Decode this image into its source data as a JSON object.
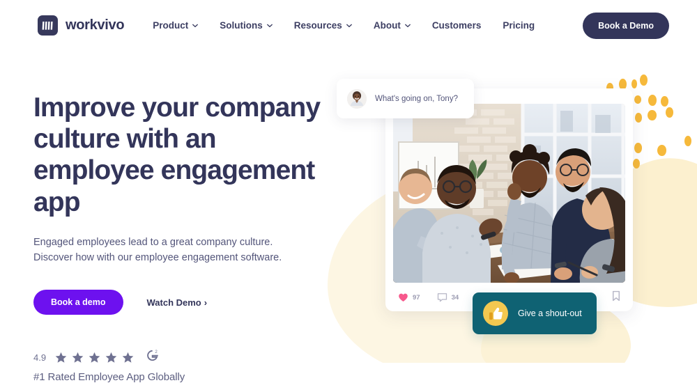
{
  "brand": {
    "name": "workvivo",
    "logo_icon": "workvivo-w-mark",
    "logo_bg": "#37395c"
  },
  "nav": {
    "items": [
      {
        "label": "Product",
        "has_dropdown": true
      },
      {
        "label": "Solutions",
        "has_dropdown": true
      },
      {
        "label": "Resources",
        "has_dropdown": true
      },
      {
        "label": "About",
        "has_dropdown": true
      },
      {
        "label": "Customers",
        "has_dropdown": false
      },
      {
        "label": "Pricing",
        "has_dropdown": false
      }
    ],
    "cta_label": "Book a Demo",
    "cta_color": "#33355a"
  },
  "hero": {
    "headline": "Improve your company culture with an employee engagement app",
    "subhead": "Engaged employees lead to a great company culture. Discover how with our employee engagement software.",
    "primary_cta": "Book a demo",
    "primary_cta_color": "#6d11ef",
    "secondary_cta": "Watch Demo",
    "secondary_cta_arrow": "›"
  },
  "rating": {
    "score": "4.9",
    "star_count": 5,
    "star_color": "#6f7191",
    "badge_icon": "g2-logo",
    "badge_label": "G",
    "badge_superscript": "2",
    "caption": "#1 Rated Employee App Globally"
  },
  "showcase": {
    "status_card": {
      "avatar_icon": "user-avatar",
      "prompt": "What's going on, Tony?"
    },
    "post": {
      "photo_alt": "team meeting around a table in an office",
      "like_icon": "heart-icon",
      "like_count": "97",
      "like_color": "#f7588c",
      "comment_icon": "comment-icon",
      "comment_count": "34",
      "bookmark_icon": "bookmark-icon"
    },
    "shoutout": {
      "icon": "thumbs-up-icon",
      "label": "Give a shout-out",
      "card_color": "#0f6273",
      "icon_bg": "#f3c850"
    }
  },
  "decor": {
    "dot_color": "#f6b93b",
    "blob_color": "#fdf6e3"
  }
}
